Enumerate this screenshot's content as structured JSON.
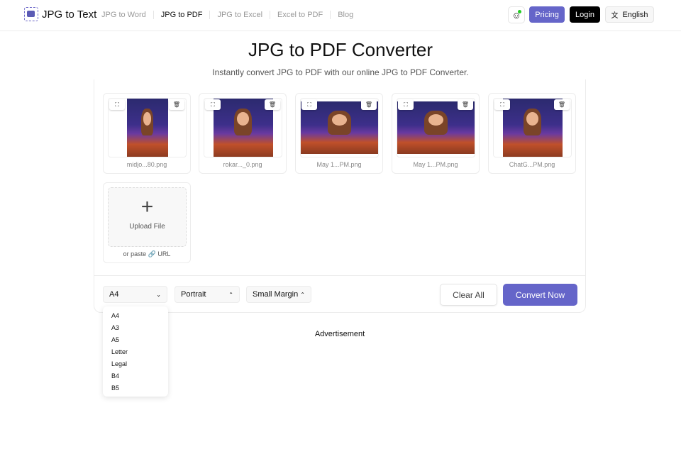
{
  "header": {
    "logo": "JPG to Text",
    "nav": [
      "JPG to Word",
      "JPG to PDF",
      "JPG to Excel",
      "Excel to PDF",
      "Blog"
    ],
    "pricing": "Pricing",
    "login": "Login",
    "language": "English"
  },
  "page": {
    "title": "JPG to PDF Converter",
    "subtitle": "Instantly convert JPG to PDF with our online JPG to PDF Converter."
  },
  "files": [
    "midjo...80.png",
    "rokar..._0.png",
    "May 1...PM.png",
    "May 1...PM.png",
    "ChatG...PM.png"
  ],
  "upload": {
    "label": "Upload File",
    "paste": "or paste",
    "url": "URL"
  },
  "controls": {
    "size": "A4",
    "orientation": "Portrait",
    "margin": "Small Margin",
    "clear": "Clear All",
    "convert": "Convert Now"
  },
  "size_options": [
    "A4",
    "A3",
    "A5",
    "Letter",
    "Legal",
    "B4",
    "B5"
  ],
  "ad": "Advertisement",
  "colors": {
    "accent": "#6565c9"
  }
}
